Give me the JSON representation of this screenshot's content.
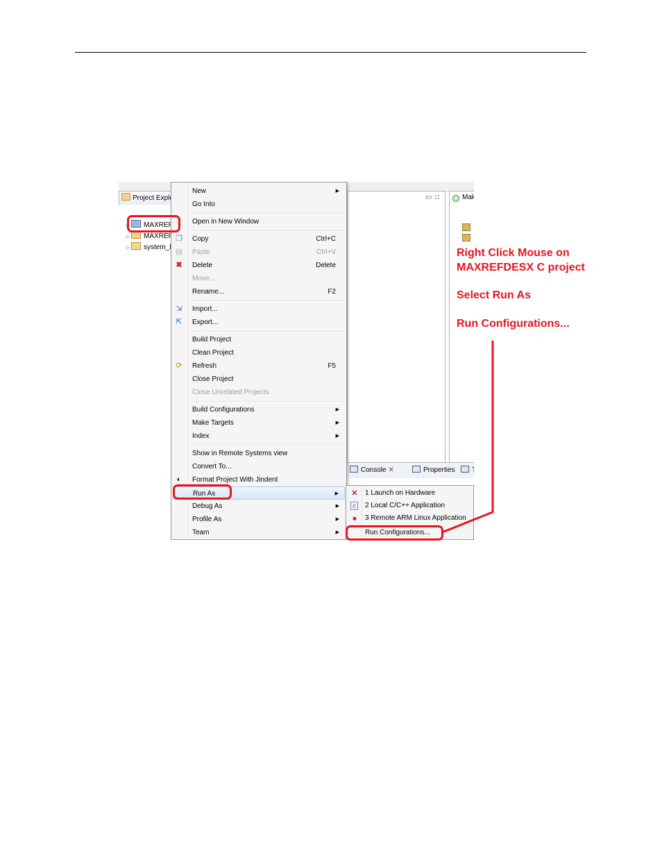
{
  "project_explorer": {
    "tab_label": "Project Explo",
    "items": [
      {
        "label": "MAXREF"
      },
      {
        "label": "MAXREF"
      },
      {
        "label": "system_l"
      }
    ]
  },
  "context_menu": {
    "items": [
      {
        "label": "New",
        "submenu": true
      },
      {
        "label": "Go Into"
      },
      {
        "label": "Open in New Window"
      },
      {
        "label": "Copy",
        "shortcut": "Ctrl+C",
        "icon": "copy-icon"
      },
      {
        "label": "Paste",
        "shortcut": "Ctrl+V",
        "disabled": true,
        "icon": "paste-icon"
      },
      {
        "label": "Delete",
        "shortcut": "Delete",
        "icon": "delete-icon"
      },
      {
        "label": "Move...",
        "disabled": true
      },
      {
        "label": "Rename...",
        "shortcut": "F2"
      },
      {
        "label": "Import...",
        "icon": "import-icon"
      },
      {
        "label": "Export...",
        "icon": "export-icon"
      },
      {
        "label": "Build Project"
      },
      {
        "label": "Clean Project"
      },
      {
        "label": "Refresh",
        "shortcut": "F5",
        "icon": "refresh-icon"
      },
      {
        "label": "Close Project"
      },
      {
        "label": "Close Unrelated Projects",
        "disabled": true
      },
      {
        "label": "Build Configurations",
        "submenu": true
      },
      {
        "label": "Make Targets",
        "submenu": true
      },
      {
        "label": "Index",
        "submenu": true
      },
      {
        "label": "Show in Remote Systems view"
      },
      {
        "label": "Convert To..."
      },
      {
        "label": "Format Project With Jindent",
        "icon": "jindent-icon"
      },
      {
        "label": "Run As",
        "submenu": true,
        "highlighted": true
      },
      {
        "label": "Debug As",
        "submenu": true
      },
      {
        "label": "Profile As",
        "submenu": true
      },
      {
        "label": "Team",
        "submenu": true
      }
    ]
  },
  "run_as_submenu": {
    "items": [
      {
        "label": "1 Launch on Hardware",
        "icon": "xilinx-icon"
      },
      {
        "label": "2 Local C/C++ Application",
        "icon": "c-app-icon"
      },
      {
        "label": "3 Remote ARM Linux Application",
        "icon": "remote-icon"
      },
      {
        "label": "Run Configurations..."
      }
    ]
  },
  "bottom_tabs": {
    "console": "Console",
    "properties": "Properties",
    "more": "T"
  },
  "outline_tab_label": "Mak",
  "annotations": {
    "line1": "Right Click Mouse on",
    "line2": "MAXREFDESX C project",
    "line3": "Select Run As",
    "line4": "Run Configurations..."
  },
  "colors": {
    "annotation_red": "#e8141e",
    "menu_bg": "#f5f5f5",
    "highlight": "#d9e8fa"
  }
}
